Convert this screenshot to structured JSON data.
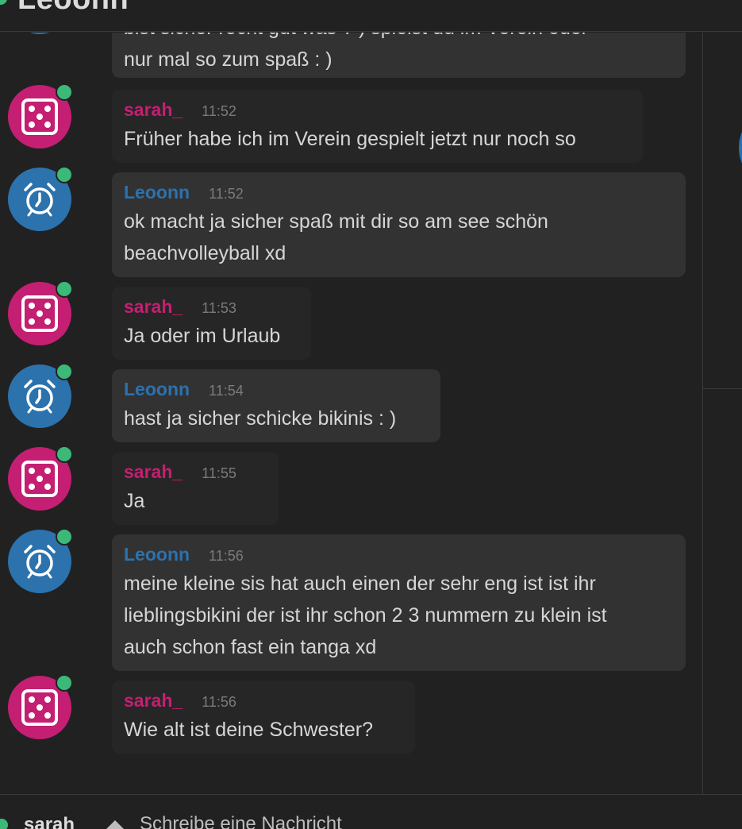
{
  "header": {
    "title": "Leoonn"
  },
  "partial_message": {
    "text": "bist sicher recht gut was ? ) spielst du im Verein oder\nnur mal so zum spaß : )"
  },
  "messages": [
    {
      "user": "sarah_",
      "time": "11:52",
      "text": "Früher habe ich im Verein gespielt jetzt nur noch so",
      "avatar": "dice-icon",
      "color": "#c41f72"
    },
    {
      "user": "Leoonn",
      "time": "11:52",
      "text": "ok macht ja sicher spaß mit dir so am see schön\nbeachvolleyball xd",
      "avatar": "alarm-clock-icon",
      "color": "#2c72ad"
    },
    {
      "user": "sarah_",
      "time": "11:53",
      "text": "Ja oder im Urlaub",
      "avatar": "dice-icon",
      "color": "#c41f72"
    },
    {
      "user": "Leoonn",
      "time": "11:54",
      "text": "hast ja sicher schicke bikinis : )",
      "avatar": "alarm-clock-icon",
      "color": "#2c72ad"
    },
    {
      "user": "sarah_",
      "time": "11:55",
      "text": "Ja",
      "avatar": "dice-icon",
      "color": "#c41f72"
    },
    {
      "user": "Leoonn",
      "time": "11:56",
      "text": "meine kleine sis hat auch einen der sehr eng ist ist ihr\nlieblingsbikini der ist ihr schon 2 3 nummern zu klein ist\nauch schon fast ein tanga xd",
      "avatar": "alarm-clock-icon",
      "color": "#2c72ad"
    },
    {
      "user": "sarah_",
      "time": "11:56",
      "text": "Wie alt ist deine Schwester?",
      "avatar": "dice-icon",
      "color": "#c41f72"
    }
  ],
  "footer": {
    "user": "sarah_",
    "placeholder": "Schreibe eine Nachricht"
  },
  "colors": {
    "background": "#212121",
    "online": "#3cb878",
    "sarah": "#c41f72",
    "leoonn": "#2c72ad"
  }
}
